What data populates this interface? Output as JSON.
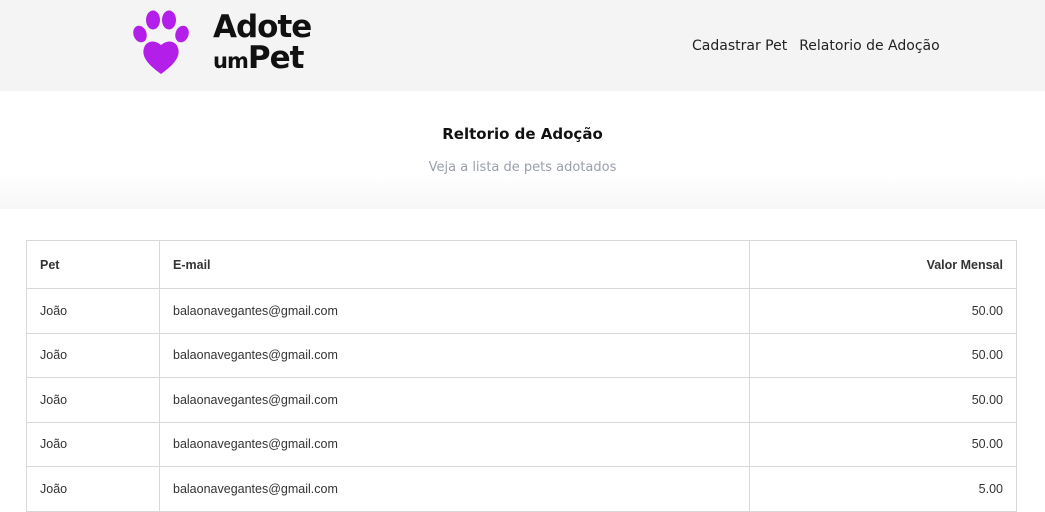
{
  "header": {
    "logo": {
      "line1": "Adote",
      "line2_small": "um",
      "line2_big": "Pet",
      "paw_color": "#b31ee8"
    },
    "nav": [
      {
        "label": "Cadastrar Pet"
      },
      {
        "label": "Relatorio de Adoção"
      }
    ]
  },
  "hero": {
    "title": "Reltorio de Adoção",
    "subtitle": "Veja a lista de pets adotados"
  },
  "table": {
    "columns": [
      "Pet",
      "E-mail",
      "Valor Mensal"
    ],
    "rows": [
      [
        "João",
        "balaonavegantes@gmail.com",
        "50.00"
      ],
      [
        "João",
        "balaonavegantes@gmail.com",
        "50.00"
      ],
      [
        "João",
        "balaonavegantes@gmail.com",
        "50.00"
      ],
      [
        "João",
        "balaonavegantes@gmail.com",
        "50.00"
      ],
      [
        "João",
        "balaonavegantes@gmail.com",
        "5.00"
      ]
    ]
  }
}
